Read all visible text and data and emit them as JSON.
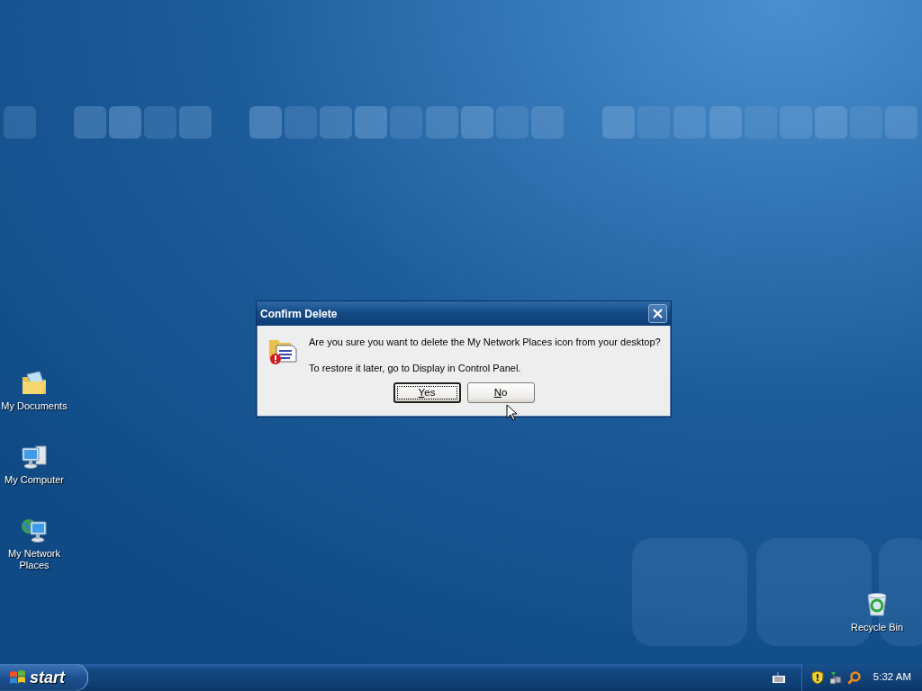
{
  "desktop_icons": [
    {
      "label": "My Documents",
      "kind": "documents"
    },
    {
      "label": "My Computer",
      "kind": "computer"
    },
    {
      "label": "My Network Places",
      "kind": "network"
    },
    {
      "label": "Recycle Bin",
      "kind": "recycle"
    }
  ],
  "dialog": {
    "title": "Confirm Delete",
    "message": "Are you sure you want to delete the My Network Places icon from your desktop?",
    "note": "To restore it later, go to Display in Control Panel.",
    "buttons": [
      {
        "label": "Yes",
        "focused": true,
        "mnemonic": true
      },
      {
        "label": "No",
        "focused": false,
        "mnemonic": true
      }
    ]
  },
  "taskbar": {
    "start_label": "start",
    "clock": "5:32 AM"
  }
}
